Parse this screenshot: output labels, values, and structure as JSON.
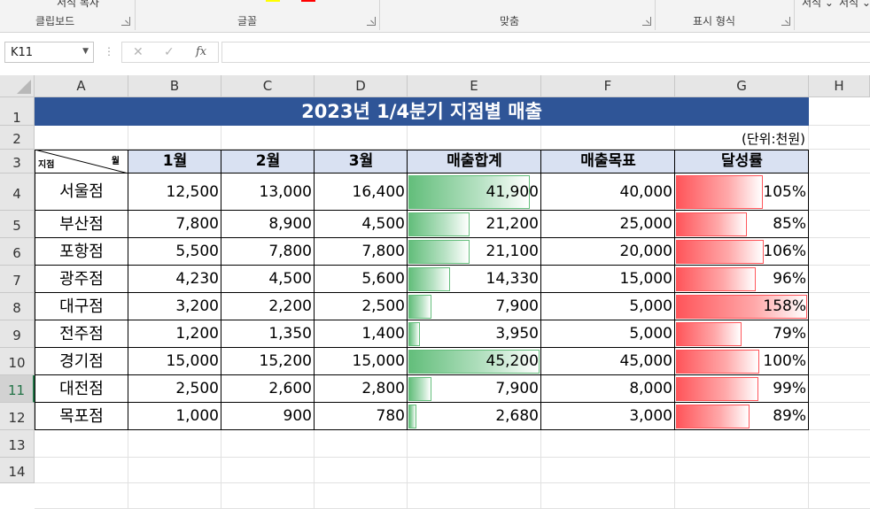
{
  "ribbon": {
    "top_items": [
      "서식 복사",
      "서식",
      "서식"
    ],
    "groups": [
      "클립보드",
      "글꼴",
      "맞춤",
      "표시 형식"
    ]
  },
  "formula_bar": {
    "name_box": "K11",
    "cancel_icon": "✕",
    "enter_icon": "✓",
    "fx_label": "fx",
    "formula": ""
  },
  "columns": [
    "A",
    "B",
    "C",
    "D",
    "E",
    "F",
    "G",
    "H"
  ],
  "rows": [
    "1",
    "2",
    "3",
    "4",
    "5",
    "6",
    "7",
    "8",
    "9",
    "10",
    "11",
    "12",
    "13",
    "14"
  ],
  "active_row": "11",
  "sheet": {
    "title": "2023년 1/4분기 지점별 매출",
    "unit": "(단위:천원)",
    "diag_top": "월",
    "diag_bottom": "지점",
    "headers": [
      "1월",
      "2월",
      "3월",
      "매출합계",
      "매출목표",
      "달성률"
    ],
    "rows": [
      {
        "branch": "서울점",
        "m1": "12,500",
        "m2": "13,000",
        "m3": "16,400",
        "total": "41,900",
        "total_value": 41900,
        "target": "40,000",
        "rate": "105%",
        "rate_value": 1.05
      },
      {
        "branch": "부산점",
        "m1": "7,800",
        "m2": "8,900",
        "m3": "4,500",
        "total": "21,200",
        "total_value": 21200,
        "target": "25,000",
        "rate": "85%",
        "rate_value": 0.85
      },
      {
        "branch": "포항점",
        "m1": "5,500",
        "m2": "7,800",
        "m3": "7,800",
        "total": "21,100",
        "total_value": 21100,
        "target": "20,000",
        "rate": "106%",
        "rate_value": 1.06
      },
      {
        "branch": "광주점",
        "m1": "4,230",
        "m2": "4,500",
        "m3": "5,600",
        "total": "14,330",
        "total_value": 14330,
        "target": "15,000",
        "rate": "96%",
        "rate_value": 0.96
      },
      {
        "branch": "대구점",
        "m1": "3,200",
        "m2": "2,200",
        "m3": "2,500",
        "total": "7,900",
        "total_value": 7900,
        "target": "5,000",
        "rate": "158%",
        "rate_value": 1.58
      },
      {
        "branch": "전주점",
        "m1": "1,200",
        "m2": "1,350",
        "m3": "1,400",
        "total": "3,950",
        "total_value": 3950,
        "target": "5,000",
        "rate": "79%",
        "rate_value": 0.79
      },
      {
        "branch": "경기점",
        "m1": "15,000",
        "m2": "15,200",
        "m3": "15,000",
        "total": "45,200",
        "total_value": 45200,
        "target": "45,000",
        "rate": "100%",
        "rate_value": 1.0
      },
      {
        "branch": "대전점",
        "m1": "2,500",
        "m2": "2,600",
        "m3": "2,800",
        "total": "7,900",
        "total_value": 7900,
        "target": "8,000",
        "rate": "99%",
        "rate_value": 0.99
      },
      {
        "branch": "목포점",
        "m1": "1,000",
        "m2": "900",
        "m3": "780",
        "total": "2,680",
        "total_value": 2680,
        "target": "3,000",
        "rate": "89%",
        "rate_value": 0.89
      }
    ]
  },
  "colors": {
    "title_fill": "#2f5597",
    "header_fill": "#d9e1f2",
    "bar_green": "#63be7b",
    "bar_red": "#ff555a"
  }
}
